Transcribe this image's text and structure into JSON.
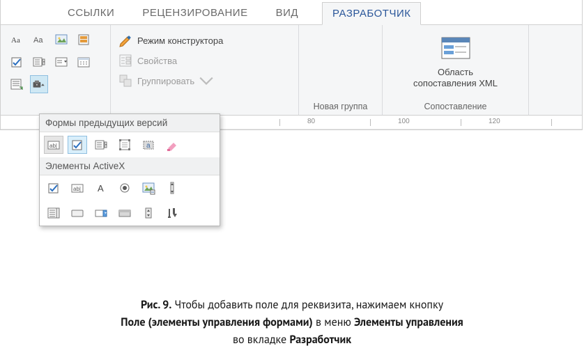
{
  "tabs": {
    "links": "ССЫЛКИ",
    "review": "РЕЦЕНЗИРОВАНИЕ",
    "view": "ВИД",
    "developer": "РАЗРАБОТЧИК"
  },
  "ribbon": {
    "constructor": {
      "design_mode": "Режим конструктора",
      "properties": "Свойства",
      "group": "Группировать"
    },
    "group_new_label": "Новая группа",
    "mapping": {
      "button_l1": "Область",
      "button_l2": "сопоставления XML",
      "group_label": "Сопоставление"
    }
  },
  "dropdown": {
    "legacy_header": "Формы предыдущих версий",
    "activex_header": "Элементы ActiveX"
  },
  "ruler": {
    "n80": "80",
    "n100": "100",
    "n120": "120"
  },
  "caption": {
    "prefix": "Рис. 9.",
    "line1_rest": " Чтобы добавить поле для реквизита, нажимаем кнопку",
    "bold1": "Поле (элементы управления формами)",
    "mid": " в меню ",
    "bold2": "Элементы управления",
    "line3_pre": "во вкладке ",
    "bold3": "Разработчик"
  }
}
